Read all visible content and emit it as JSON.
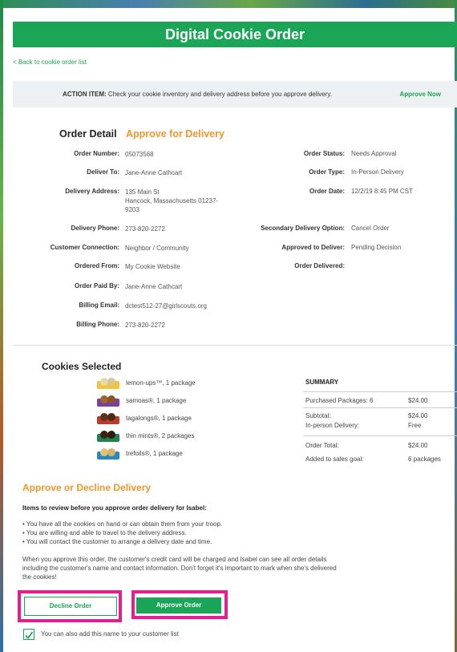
{
  "header": {
    "title": "Digital Cookie Order"
  },
  "nav": {
    "back_label": "< Back to cookie order list"
  },
  "action_item": {
    "label": "ACTION ITEM:",
    "message": "Check your cookie inventory and delivery address before you approve delivery.",
    "approve_now": "Approve Now"
  },
  "order_detail": {
    "title": "Order Detail",
    "subtitle": "Approve for Delivery",
    "left": [
      {
        "label": "Order Number:",
        "value": "05073568"
      },
      {
        "label": "Deliver To:",
        "value": "Jane-Anne Cathcart"
      },
      {
        "label": "Delivery Address:",
        "value_lines": [
          "135 Main St",
          "Hancock, Massachusetts 01237-",
          "9203"
        ]
      },
      {
        "label": "Delivery Phone:",
        "value": "273-820-2272"
      },
      {
        "label": "Customer Connection:",
        "value": "Neighbor / Community"
      },
      {
        "label": "Ordered From:",
        "value": "My Cookie Website"
      },
      {
        "label": "Order Paid By:",
        "value": "Jane-Anne Cathcart"
      },
      {
        "label": "Billing Email:",
        "value": "dctest512-27@girlscouts.org"
      },
      {
        "label": "Billing Phone:",
        "value": "273-820-2272"
      }
    ],
    "right": [
      {
        "label": "Order Status:",
        "value": "Needs Approval"
      },
      {
        "label": "Order Type:",
        "value": "In-Person Delivery"
      },
      {
        "label": "Order Date:",
        "value": "12/2/19 8:45 PM CST"
      },
      {
        "label": "Secondary Delivery Option:",
        "value": "Cancel Order"
      },
      {
        "label": "Approved to Deliver:",
        "value": "Pending Decision"
      },
      {
        "label": "Order Delivered:",
        "value": ""
      }
    ]
  },
  "cookies": {
    "title": "Cookies Selected",
    "items": [
      {
        "name": "lemon-ups™, 1 package",
        "color": "#f2c53d"
      },
      {
        "name": "samoas®, 1 package",
        "color": "#7b3fa0"
      },
      {
        "name": "tagalongs®, 1 package",
        "color": "#c0392b"
      },
      {
        "name": "thin mints®, 2 packages",
        "color": "#1e8449"
      },
      {
        "name": "trefoils®, 1 package",
        "color": "#2e86c1"
      }
    ]
  },
  "summary": {
    "title": "SUMMARY",
    "purchased_label": "Purchased Packages: 6",
    "purchased_value": "$24.00",
    "subtotal_label": "Subtotal:",
    "subtotal_value": "$24.00",
    "delivery_label": "In-person Delivery:",
    "delivery_value": "Free",
    "total_label": "Order Total:",
    "total_value": "$24.00",
    "goal_label": "Added to sales goal:",
    "goal_value": "6 packages"
  },
  "approve_decline": {
    "title": "Approve or Decline Delivery",
    "review_heading": "Items to review before you approve order delivery for Isabel:",
    "bullets": [
      "• You have all the cookies on hand or can obtain them from your troop.",
      "• You are willing and able to travel to the delivery address.",
      "• You will contact the customer to arrange a delivery date and time."
    ],
    "paragraph": "When you approve this order, the customer's credit card will be charged and Isabel can see all order details including the customer's name and contact information. Don't forget it's important to mark when she's delivered the cookies!",
    "decline_label": "Decline Order",
    "approve_label": "Approve Order",
    "checkbox_label": "You can also add this name to your customer list",
    "checkbox_checked": true
  }
}
